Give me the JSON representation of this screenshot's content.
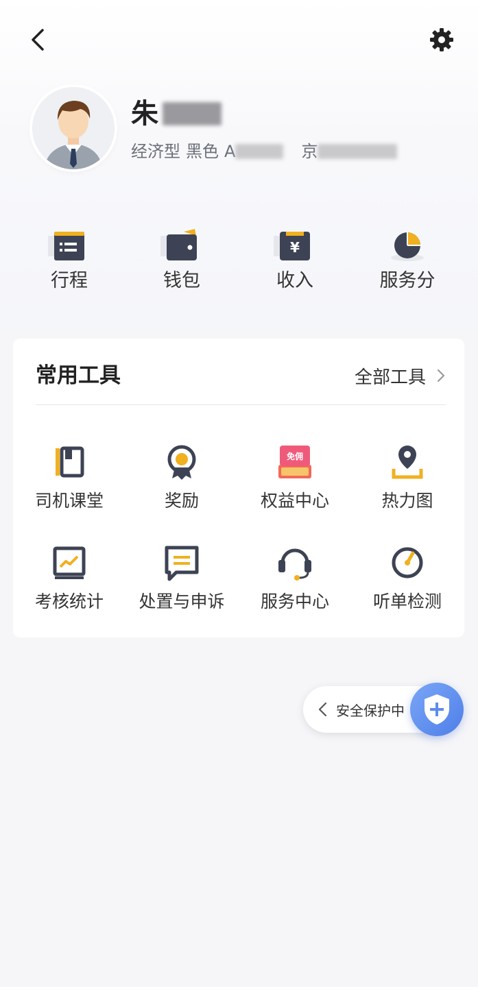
{
  "header": {
    "back_icon": "chevron-left-icon",
    "settings_icon": "gear-icon"
  },
  "profile": {
    "name": "朱",
    "vehicle_type": "经济型",
    "vehicle_color": "黑色",
    "plate_prefix": "A",
    "city_prefix": "京"
  },
  "quick_entries": [
    {
      "label": "行程",
      "icon": "itinerary-icon"
    },
    {
      "label": "钱包",
      "icon": "wallet-icon"
    },
    {
      "label": "收入",
      "icon": "income-icon"
    },
    {
      "label": "服务分",
      "icon": "service-score-icon"
    }
  ],
  "tools": {
    "title": "常用工具",
    "all_tools_label": "全部工具",
    "items": [
      {
        "label": "司机课堂",
        "icon": "book-icon"
      },
      {
        "label": "奖励",
        "icon": "medal-icon"
      },
      {
        "label": "权益中心",
        "icon": "gift-coupon-icon",
        "badge": "免佣"
      },
      {
        "label": "热力图",
        "icon": "location-pin-icon"
      },
      {
        "label": "考核统计",
        "icon": "stats-chart-icon"
      },
      {
        "label": "处置与申诉",
        "icon": "message-icon"
      },
      {
        "label": "服务中心",
        "icon": "headset-icon"
      },
      {
        "label": "听单检测",
        "icon": "gauge-icon"
      }
    ]
  },
  "safety": {
    "label": "安全保护中",
    "icon": "shield-plus-icon"
  },
  "colors": {
    "accent": "#f0b020",
    "icon_dark": "#3d4354",
    "shield_blue": "#5b8def",
    "coupon_red": "#f05a63"
  }
}
